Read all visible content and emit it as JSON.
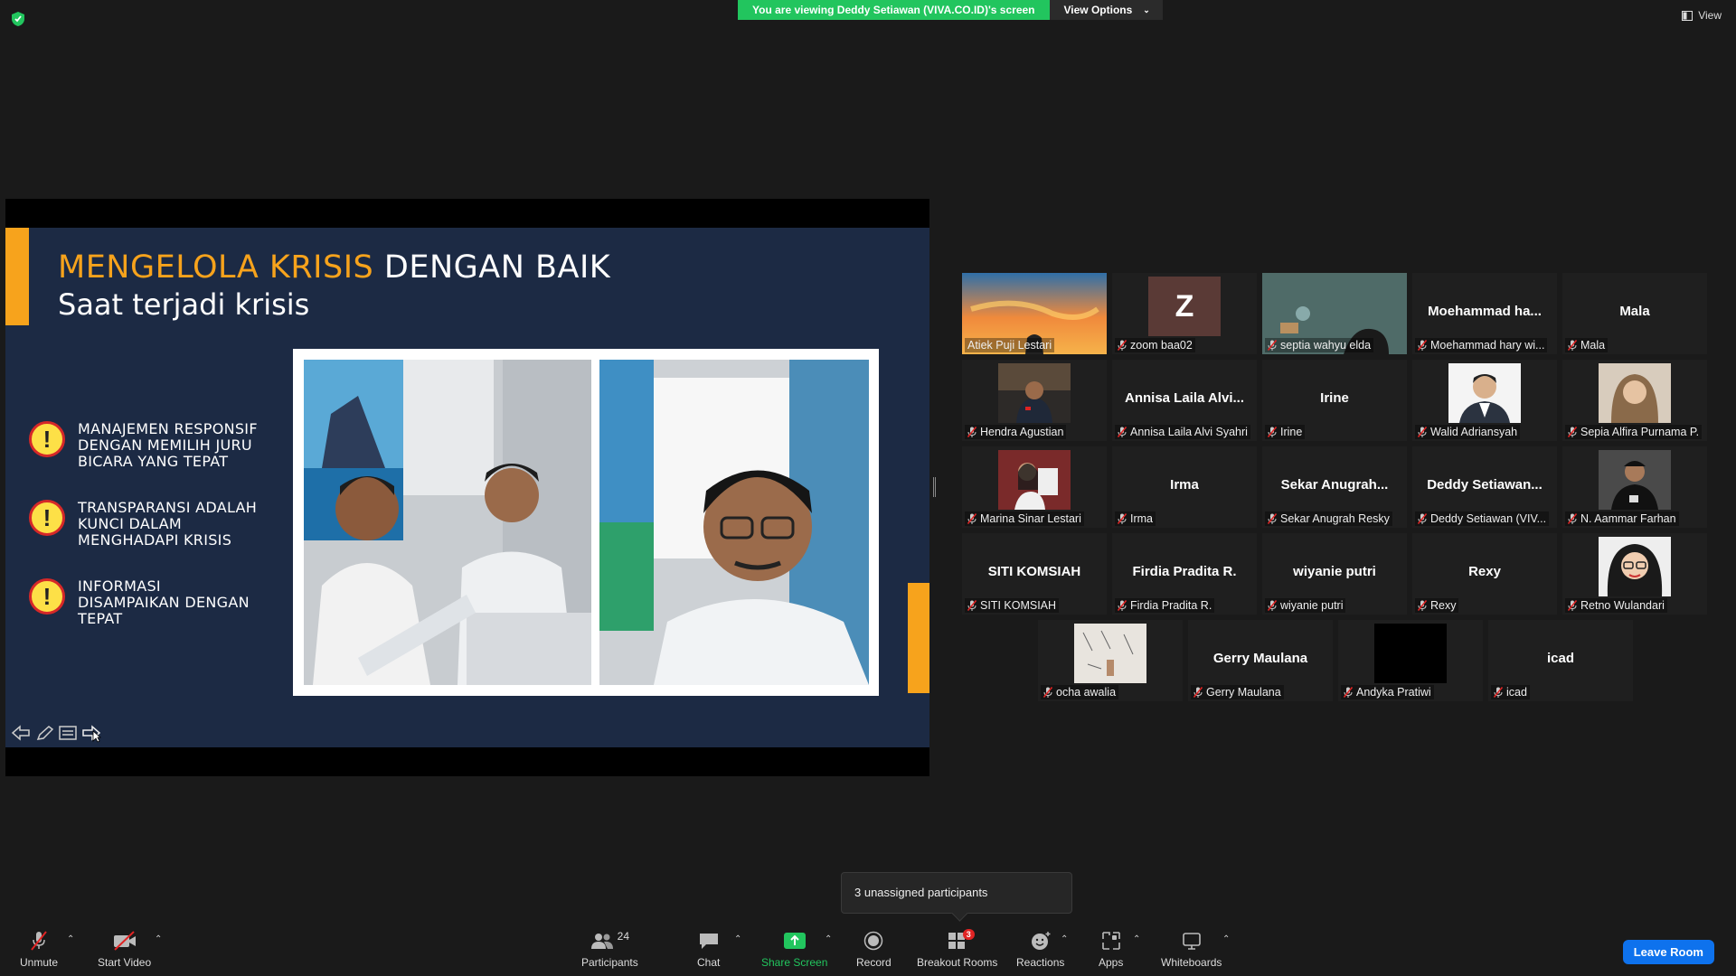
{
  "top": {
    "banner": "You are viewing Deddy Setiawan (VIVA.CO.ID)'s screen",
    "view_options": "View Options",
    "view": "View"
  },
  "slide": {
    "title_orange": "MENGELOLA KRISIS",
    "title_white": "DENGAN BAIK",
    "subtitle": "Saat terjadi krisis",
    "bullets": [
      "MANAJEMEN RESPONSIF DENGAN MEMILIH JURU BICARA YANG TEPAT",
      "TRANSPARANSI ADALAH KUNCI DALAM MENGHADAPI KRISIS",
      "INFORMASI DISAMPAIKAN DENGAN TEPAT"
    ]
  },
  "gallery": {
    "tiles": [
      {
        "label": "Atiek Puji Lestari",
        "center": "",
        "kind": "video-sunset",
        "muted": false,
        "active": true
      },
      {
        "label": "zoom baa02",
        "center": "",
        "kind": "letter",
        "letter": "Z",
        "muted": true
      },
      {
        "label": "septia wahyu elda",
        "center": "",
        "kind": "video-room",
        "muted": true
      },
      {
        "label": "Moehammad hary wi...",
        "center": "Moehammad ha...",
        "kind": "name",
        "muted": true
      },
      {
        "label": "Mala",
        "center": "Mala",
        "kind": "name",
        "muted": true
      },
      {
        "label": "Hendra Agustian",
        "center": "",
        "kind": "photo-books",
        "muted": true
      },
      {
        "label": "Annisa Laila Alvi Syahri",
        "center": "Annisa Laila Alvi...",
        "kind": "name",
        "muted": true
      },
      {
        "label": "Irine",
        "center": "Irine",
        "kind": "name",
        "muted": true
      },
      {
        "label": "Walid Adriansyah",
        "center": "",
        "kind": "photo-suit",
        "muted": true
      },
      {
        "label": "Sepia Alfira Purnama P.",
        "center": "",
        "kind": "photo-hijab",
        "muted": true
      },
      {
        "label": "Marina Sinar Lestari",
        "center": "",
        "kind": "photo-red",
        "muted": true
      },
      {
        "label": "Irma",
        "center": "Irma",
        "kind": "name",
        "muted": true
      },
      {
        "label": "Sekar Anugrah Resky",
        "center": "Sekar Anugrah...",
        "kind": "name",
        "muted": true
      },
      {
        "label": "Deddy Setiawan (VIV...",
        "center": "Deddy Setiawan...",
        "kind": "name",
        "muted": true
      },
      {
        "label": "N. Aammar Farhan",
        "center": "",
        "kind": "photo-dark",
        "muted": true
      },
      {
        "label": "SITI KOMSIAH",
        "center": "SITI KOMSIAH",
        "kind": "name",
        "muted": true
      },
      {
        "label": "Firdia Pradita R.",
        "center": "Firdia Pradita R.",
        "kind": "name",
        "muted": true
      },
      {
        "label": "wiyanie putri",
        "center": "wiyanie putri",
        "kind": "name",
        "muted": true
      },
      {
        "label": "Rexy",
        "center": "Rexy",
        "kind": "name",
        "muted": true
      },
      {
        "label": "Retno Wulandari",
        "center": "",
        "kind": "photo-glasses",
        "muted": true
      },
      {
        "label": "ocha awalia",
        "center": "",
        "kind": "photo-wall",
        "muted": true
      },
      {
        "label": "Gerry Maulana",
        "center": "Gerry Maulana",
        "kind": "name",
        "muted": true
      },
      {
        "label": "Andyka Pratiwi",
        "center": "",
        "kind": "black",
        "muted": true
      },
      {
        "label": "icad",
        "center": "icad",
        "kind": "name",
        "muted": true
      }
    ]
  },
  "toast": "3 unassigned participants",
  "toolbar": {
    "unmute": "Unmute",
    "start_video": "Start Video",
    "participants": "Participants",
    "participants_count": "24",
    "chat": "Chat",
    "share_screen": "Share Screen",
    "record": "Record",
    "breakout_rooms": "Breakout Rooms",
    "breakout_badge": "3",
    "reactions": "Reactions",
    "apps": "Apps",
    "whiteboards": "Whiteboards",
    "leave": "Leave Room"
  },
  "colors": {
    "accent_orange": "#f7a31c",
    "slide_bg": "#1c2a44",
    "banner_green": "#22c55e",
    "leave_blue": "#0e72ed",
    "active_tile": "#e3e34a"
  }
}
